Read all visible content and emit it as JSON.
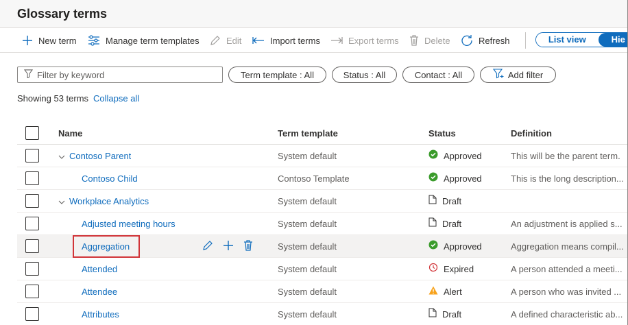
{
  "header": {
    "title": "Glossary terms"
  },
  "toolbar": {
    "new_term": "New term",
    "manage_templates": "Manage term templates",
    "edit": "Edit",
    "import_terms": "Import terms",
    "export_terms": "Export terms",
    "delete": "Delete",
    "refresh": "Refresh"
  },
  "view_toggle": {
    "list": "List view",
    "hier": "Hie"
  },
  "filters": {
    "keyword_placeholder": "Filter by keyword",
    "term_template": "Term template : All",
    "status": "Status : All",
    "contact": "Contact : All",
    "add_filter": "Add filter"
  },
  "summary": {
    "showing": "Showing 53 terms",
    "collapse_all": "Collapse all"
  },
  "table": {
    "headers": {
      "name": "Name",
      "template": "Term template",
      "status": "Status",
      "definition": "Definition"
    },
    "rows": [
      {
        "name": "Contoso Parent",
        "template": "System default",
        "status": "Approved",
        "definition": "This will be the parent term."
      },
      {
        "name": "Contoso Child",
        "template": "Contoso Template",
        "status": "Approved",
        "definition": "This is the long description..."
      },
      {
        "name": "Workplace Analytics",
        "template": "System default",
        "status": "Draft",
        "definition": ""
      },
      {
        "name": "Adjusted meeting hours",
        "template": "System default",
        "status": "Draft",
        "definition": "An adjustment is applied s..."
      },
      {
        "name": "Aggregation",
        "template": "System default",
        "status": "Approved",
        "definition": "Aggregation means compil..."
      },
      {
        "name": "Attended",
        "template": "System default",
        "status": "Expired",
        "definition": "A person attended a meeti..."
      },
      {
        "name": "Attendee",
        "template": "System default",
        "status": "Alert",
        "definition": "A person who was invited ..."
      },
      {
        "name": "Attributes",
        "template": "System default",
        "status": "Draft",
        "definition": "A defined characteristic ab..."
      }
    ]
  },
  "colors": {
    "accent": "#0f6cbd",
    "approved": "#3a9b2b",
    "expired": "#d13438",
    "alert": "#f7a21b",
    "highlight": "#d13438"
  }
}
